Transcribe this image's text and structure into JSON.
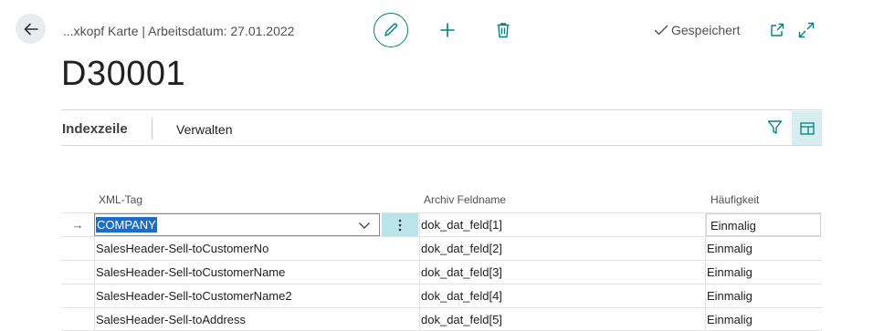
{
  "header": {
    "breadcrumb": "...xkopf Karte | Arbeitsdatum: 27.01.2022",
    "title": "D30001",
    "saved_status": "Gespeichert"
  },
  "subpage": {
    "tab_label": "Indexzeile",
    "action_label": "Verwalten"
  },
  "table": {
    "columns": [
      "XML-Tag",
      "Archiv Feldname",
      "Häufigkeit"
    ],
    "rows": [
      {
        "indicator": "→",
        "xml_tag": "COMPANY",
        "archiv_feldname": "dok_dat_feld[1]",
        "haeufigkeit": "Einmalig"
      },
      {
        "indicator": "",
        "xml_tag": "SalesHeader-Sell-toCustomerNo",
        "archiv_feldname": "dok_dat_feld[2]",
        "haeufigkeit": "Einmalig"
      },
      {
        "indicator": "",
        "xml_tag": "SalesHeader-Sell-toCustomerName",
        "archiv_feldname": "dok_dat_feld[3]",
        "haeufigkeit": "Einmalig"
      },
      {
        "indicator": "",
        "xml_tag": "SalesHeader-Sell-toCustomerName2",
        "archiv_feldname": "dok_dat_feld[4]",
        "haeufigkeit": "Einmalig"
      },
      {
        "indicator": "",
        "xml_tag": "SalesHeader-Sell-toAddress",
        "archiv_feldname": "dok_dat_feld[5]",
        "haeufigkeit": "Einmalig"
      }
    ]
  },
  "colors": {
    "accent": "#00837a",
    "selection": "#1a6ec9",
    "active_cell": "#b9e5e8"
  },
  "icons": [
    "back-arrow-icon",
    "pencil-icon",
    "plus-icon",
    "trash-icon",
    "checkmark-icon",
    "open-new-window-icon",
    "expand-icon",
    "filter-icon",
    "layout-icon",
    "chevron-down-icon",
    "more-vertical-icon",
    "row-arrow-icon"
  ]
}
